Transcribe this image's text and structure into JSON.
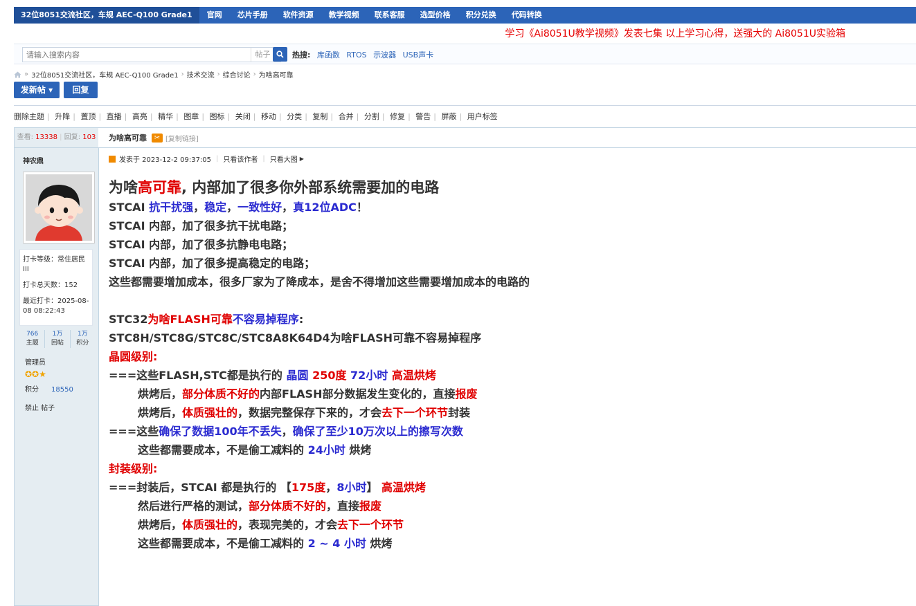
{
  "topnav": {
    "site": "32位8051交流社区，车规 AEC-Q100 Grade1",
    "items": [
      "官网",
      "芯片手册",
      "软件资源",
      "教学视频",
      "联系客服",
      "选型价格",
      "积分兑换",
      "代码转换"
    ]
  },
  "promo": "学习《Ai8051U教学视频》发表七集 以上学习心得，送强大的 Ai8051U实验箱",
  "search": {
    "placeholder": "请输入搜索内容",
    "type": "帖子",
    "hot_label": "热搜:",
    "hot": [
      "库函数",
      "RTOS",
      "示波器",
      "USB声卡"
    ]
  },
  "breadcrumb": [
    "32位8051交流社区，车规 AEC-Q100 Grade1",
    "技术交流",
    "综合讨论",
    "为啥高可靠"
  ],
  "buttons": {
    "new_post": "发新帖",
    "reply": "回复"
  },
  "mod_tools": [
    "删除主题",
    "升降",
    "置顶",
    "直播",
    "高亮",
    "精华",
    "图章",
    "图标",
    "关闭",
    "移动",
    "分类",
    "复制",
    "合并",
    "分割",
    "修复",
    "警告",
    "屏蔽",
    "用户标签"
  ],
  "stats": {
    "views_label": "查看:",
    "views": "13338",
    "replies_label": "回复:",
    "replies": "103"
  },
  "author": {
    "name": "神农鼎",
    "checkin_level": "打卡等级：常住居民III",
    "checkin_days": "打卡总天数：152",
    "last_checkin": "最近打卡：2025-08-08 08:22:43",
    "counts": [
      {
        "num": "766",
        "label": "主题"
      },
      {
        "num": "1万",
        "label": "回帖"
      },
      {
        "num": "1万",
        "label": "积分"
      }
    ],
    "role": "管理员",
    "stars": "✪✪★",
    "points_label": "积分",
    "points": "18550",
    "ban": "禁止 帖子"
  },
  "post": {
    "title": "为啥高可靠",
    "copy_link": "[复制链接]",
    "posted": "发表于 2023-12-2 09:37:05",
    "only_author": "只看该作者",
    "only_big": "只看大图"
  },
  "content": {
    "l1a": "为啥",
    "l1b": "高可靠",
    "l1c": ", 内部加了很多你外部系统需要加的电路",
    "l2a": "STCAI ",
    "l2b": "抗干扰强",
    "l2c": "，",
    "l2d": "稳定",
    "l2e": "，",
    "l2f": "一致性好",
    "l2g": "，",
    "l2h": "真12位ADC",
    "l2i": "！",
    "l3": "STCAI 内部，加了很多抗干扰电路；",
    "l4": "STCAI 内部，加了很多抗静电电路；",
    "l5": "STCAI 内部，加了很多提高稳定的电路；",
    "l6": "这些都需要增加成本，很多厂家为了降成本，是舍不得增加这些需要增加成本的电路的",
    "l7a": "STC32",
    "l7b": "为啥FLASH可靠",
    "l7c": "不容易掉程序",
    "l7d": ":",
    "l8": "STC8H/STC8G/STC8C/STC8A8K64D4为啥FLASH可靠不容易掉程序",
    "l9": "晶圆级别:",
    "l10a": "===这些FLASH,STC都是执行的 ",
    "l10b": "晶圆 ",
    "l10c": "250度 ",
    "l10d": "72小时 ",
    "l10e": "高温烘烤",
    "l11a": "烘烤后，",
    "l11b": "部分体质不好的",
    "l11c": "内部FLASH部分数据发生变化的，直接",
    "l11d": "报废",
    "l12a": "烘烤后，",
    "l12b": "体质强壮的",
    "l12c": "，数据完整保存下来的，才会",
    "l12d": "去下一个环节",
    "l12e": "封装",
    "l13a": "===这些",
    "l13b": "确保了数据100年不丢失",
    "l13c": "，",
    "l13d": "确保了至少10万次以上的擦写次数",
    "l14a": "这些都需要成本，不是偷工减料的 ",
    "l14b": "24小时",
    "l14c": " 烘烤",
    "l15": "封装级别:",
    "l16a": "===封装后，STCAI 都是执行的 【",
    "l16b": "175度",
    "l16c": "，",
    "l16d": "8小时",
    "l16e": "】 ",
    "l16f": "高温烘烤",
    "l17a": "然后进行严格的测试，",
    "l17b": "部分体质不好的",
    "l17c": "，直接",
    "l17d": "报废",
    "l18a": "烘烤后，",
    "l18b": "体质强壮的",
    "l18c": "，表现完美的，才会",
    "l18d": "去下一个环节",
    "l19a": "这些都需要成本，不是偷工减料的 ",
    "l19b": "2 ~ 4 小时",
    "l19c": " 烘烤"
  }
}
